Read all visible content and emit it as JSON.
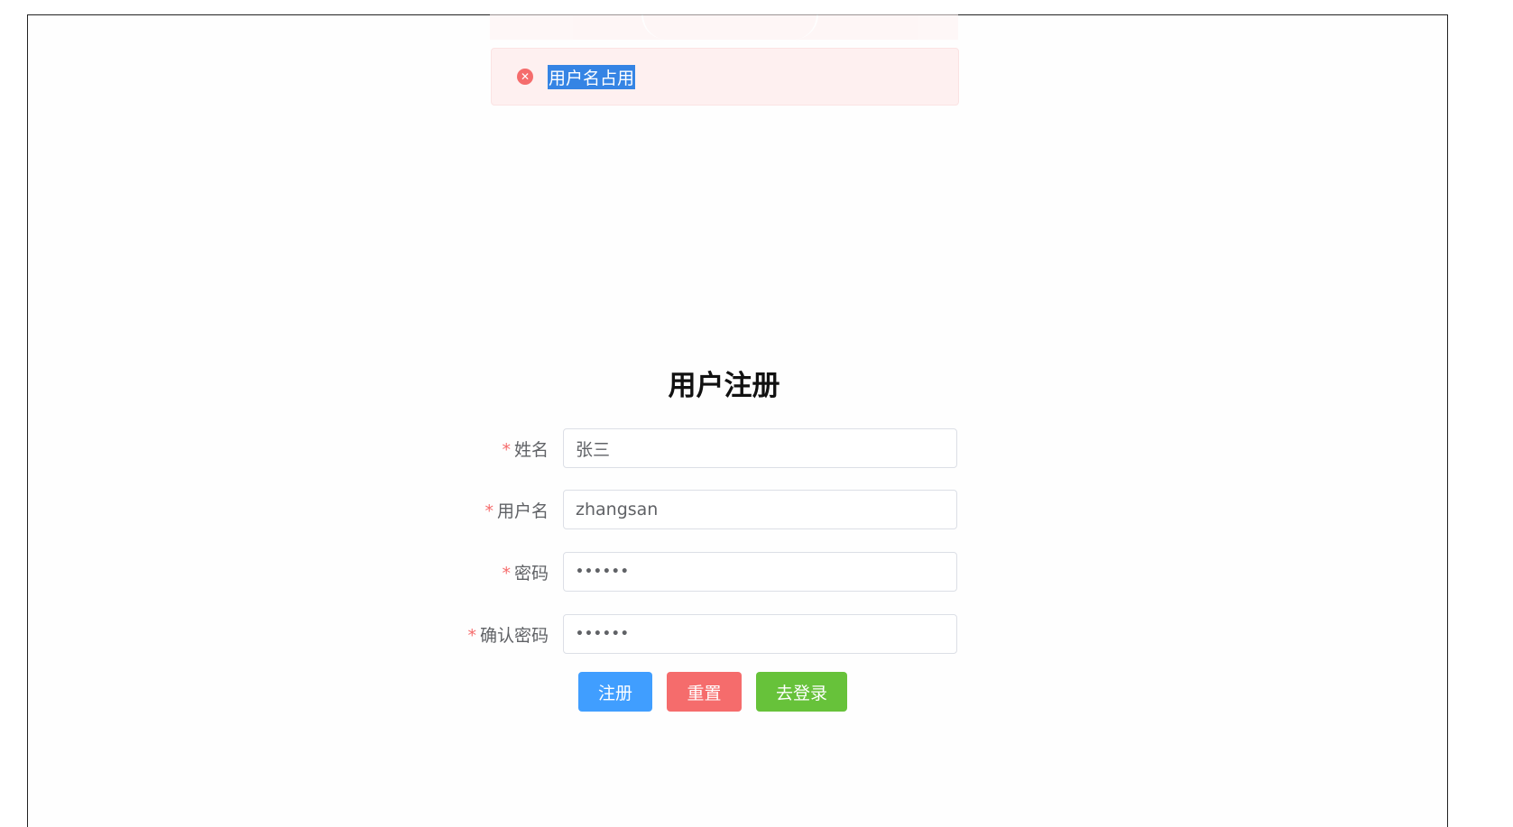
{
  "toast": {
    "icon": "error-circle-icon",
    "message": "用户名占用"
  },
  "form": {
    "title": "用户注册",
    "required_mark": "*",
    "fields": [
      {
        "label": "姓名",
        "value": "张三"
      },
      {
        "label": "用户名",
        "value": "zhangsan"
      },
      {
        "label": "密码",
        "value": "••••••"
      },
      {
        "label": "确认密码",
        "value": "••••••"
      }
    ],
    "buttons": {
      "register": "注册",
      "reset": "重置",
      "login": "去登录"
    }
  },
  "colors": {
    "primary": "#409eff",
    "danger": "#f56c6c",
    "success": "#67c23a",
    "toast_bg": "#fef0f0"
  }
}
